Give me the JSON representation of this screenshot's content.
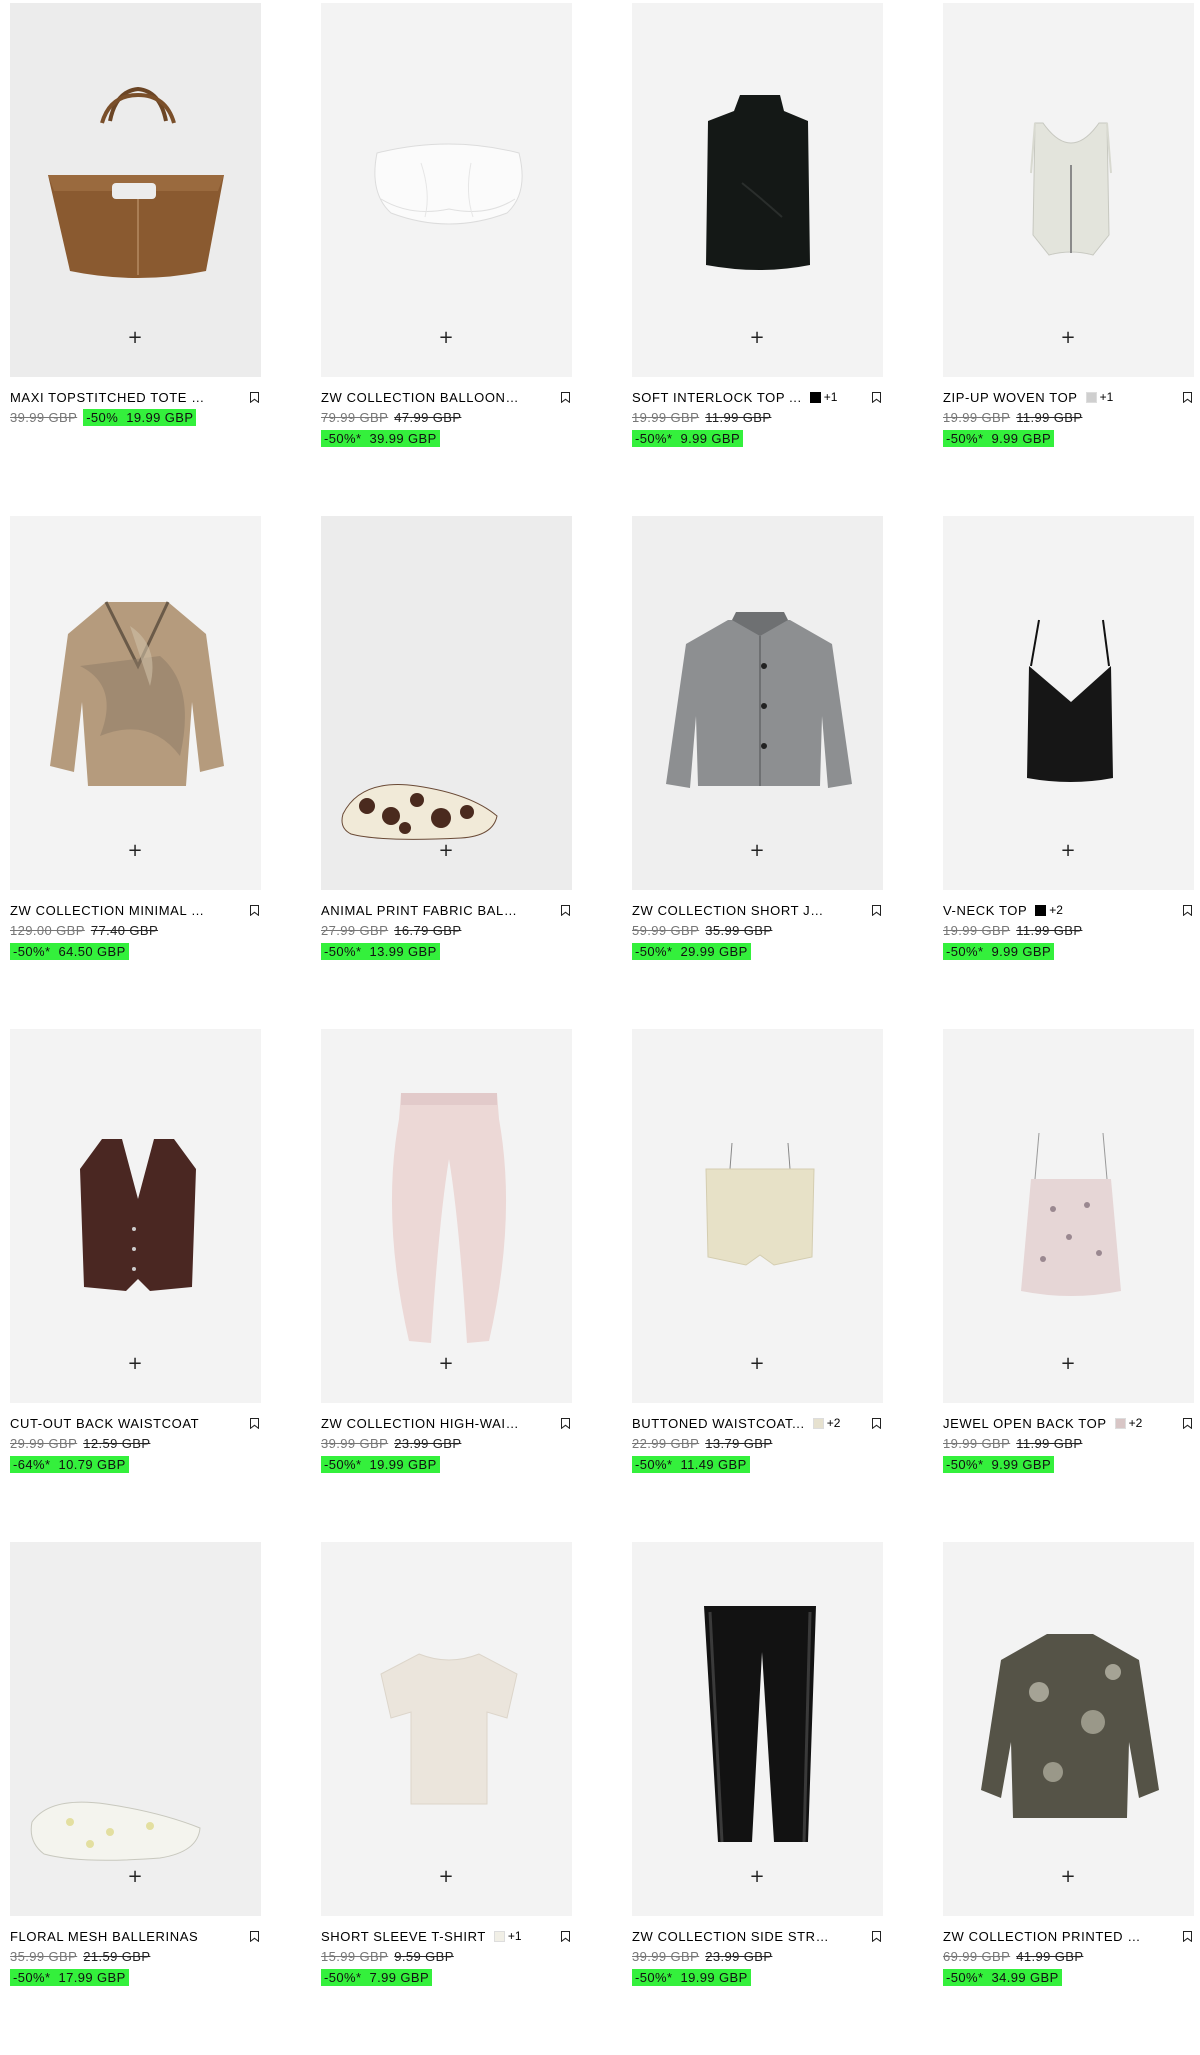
{
  "products": [
    {
      "name": "MAXI TOPSTITCHED TOTE BAG",
      "original_price": "39.99 GBP",
      "discount": "-50%",
      "sale_price": "19.99 GBP",
      "inline_sale": true,
      "swatch_color": "",
      "more_colors": "",
      "image": "tote-bag",
      "image_bg": "#ececec"
    },
    {
      "name": "ZW COLLECTION BALLOON ...",
      "original_price": "79.99 GBP",
      "mid_price": "47.99 GBP",
      "discount": "-50%*",
      "sale_price": "39.99 GBP",
      "swatch_color": "",
      "more_colors": "",
      "image": "balloon-skirt",
      "image_bg": "#f3f3f3"
    },
    {
      "name": "SOFT INTERLOCK TOP ...",
      "original_price": "19.99 GBP",
      "mid_price": "11.99 GBP",
      "discount": "-50%*",
      "sale_price": "9.99 GBP",
      "swatch_color": "#000000",
      "more_colors": "+1",
      "image": "black-top",
      "image_bg": "#f3f3f3"
    },
    {
      "name": "ZIP-UP WOVEN TOP",
      "original_price": "19.99 GBP",
      "mid_price": "11.99 GBP",
      "discount": "-50%*",
      "sale_price": "9.99 GBP",
      "swatch_color": "#cfcfcf",
      "more_colors": "+1",
      "image": "zip-top",
      "image_bg": "#f3f3f3"
    },
    {
      "name": "ZW COLLECTION MINIMAL P...",
      "original_price": "129.00 GBP",
      "mid_price": "77.40 GBP",
      "discount": "-50%*",
      "sale_price": "64.50 GBP",
      "swatch_color": "",
      "more_colors": "",
      "image": "blazer",
      "image_bg": "#f3f3f3"
    },
    {
      "name": "ANIMAL PRINT FABRIC BALLE...",
      "original_price": "27.99 GBP",
      "mid_price": "16.79 GBP",
      "discount": "-50%*",
      "sale_price": "13.99 GBP",
      "swatch_color": "",
      "more_colors": "",
      "image": "animal-flat",
      "image_bg": "#ececec"
    },
    {
      "name": "ZW COLLECTION SHORT JAC...",
      "original_price": "59.99 GBP",
      "mid_price": "35.99 GBP",
      "discount": "-50%*",
      "sale_price": "29.99 GBP",
      "swatch_color": "",
      "more_colors": "",
      "image": "grey-jacket",
      "image_bg": "#efefef"
    },
    {
      "name": "V-NECK TOP",
      "original_price": "19.99 GBP",
      "mid_price": "11.99 GBP",
      "discount": "-50%*",
      "sale_price": "9.99 GBP",
      "swatch_color": "#000000",
      "more_colors": "+2",
      "image": "cami",
      "image_bg": "#f3f3f3"
    },
    {
      "name": "CUT-OUT BACK WAISTCOAT",
      "original_price": "29.99 GBP",
      "mid_price": "12.59 GBP",
      "discount": "-64%*",
      "sale_price": "10.79 GBP",
      "swatch_color": "",
      "more_colors": "",
      "image": "brown-waistcoat",
      "image_bg": "#f3f3f3"
    },
    {
      "name": "ZW COLLECTION HIGH-WAIS...",
      "original_price": "39.99 GBP",
      "mid_price": "23.99 GBP",
      "discount": "-50%*",
      "sale_price": "19.99 GBP",
      "swatch_color": "",
      "more_colors": "",
      "image": "pink-jeans",
      "image_bg": "#f3f3f3"
    },
    {
      "name": "BUTTONED WAISTCOAT...",
      "original_price": "22.99 GBP",
      "mid_price": "13.79 GBP",
      "discount": "-50%*",
      "sale_price": "11.49 GBP",
      "swatch_color": "#e6e1cf",
      "more_colors": "+2",
      "image": "cream-waistcoat",
      "image_bg": "#f3f3f3"
    },
    {
      "name": "JEWEL OPEN BACK TOP",
      "original_price": "19.99 GBP",
      "mid_price": "11.99 GBP",
      "discount": "-50%*",
      "sale_price": "9.99 GBP",
      "swatch_color": "#d8c6c6",
      "more_colors": "+2",
      "image": "pink-cami",
      "image_bg": "#f3f3f3"
    },
    {
      "name": "FLORAL MESH BALLERINAS",
      "original_price": "35.99 GBP",
      "mid_price": "21.59 GBP",
      "discount": "-50%*",
      "sale_price": "17.99 GBP",
      "swatch_color": "",
      "more_colors": "",
      "image": "mesh-flat",
      "image_bg": "#efefef"
    },
    {
      "name": "SHORT SLEEVE T-SHIRT",
      "original_price": "15.99 GBP",
      "mid_price": "9.59 GBP",
      "discount": "-50%*",
      "sale_price": "7.99 GBP",
      "swatch_color": "#f1efe6",
      "more_colors": "+1",
      "image": "tshirt",
      "image_bg": "#f3f3f3"
    },
    {
      "name": "ZW COLLECTION SIDE STRIP...",
      "original_price": "39.99 GBP",
      "mid_price": "23.99 GBP",
      "discount": "-50%*",
      "sale_price": "19.99 GBP",
      "swatch_color": "",
      "more_colors": "",
      "image": "black-trousers",
      "image_bg": "#f3f3f3"
    },
    {
      "name": "ZW COLLECTION PRINTED S...",
      "original_price": "69.99 GBP",
      "mid_price": "41.99 GBP",
      "discount": "-50%*",
      "sale_price": "34.99 GBP",
      "swatch_color": "",
      "more_colors": "",
      "image": "paisley-shirt",
      "image_bg": "#f3f3f3"
    }
  ],
  "add_icon": "plus-icon",
  "bookmark_icon": "bookmark-icon",
  "highlight_color": "#34f03c"
}
